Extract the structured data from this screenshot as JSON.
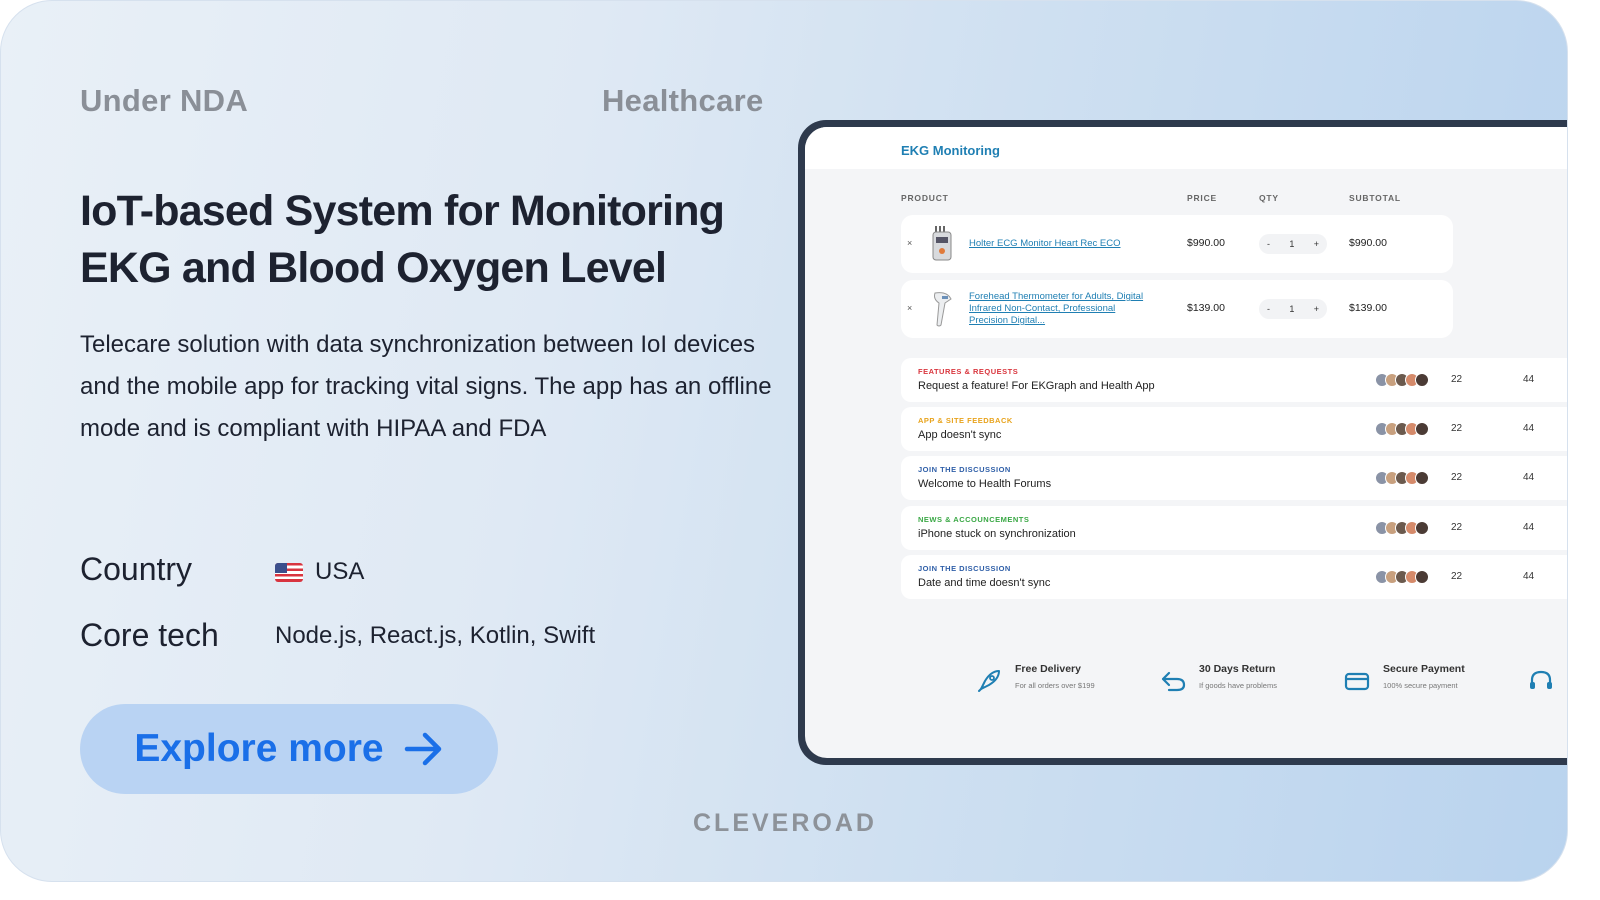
{
  "card": {
    "tag_left": "Under NDA",
    "tag_right": "Healthcare",
    "title": "IoT-based System for Monitoring EKG and Blood Oxygen Level",
    "description": "Telecare solution with data synchronization between IoI devices and the mobile app for tracking vital signs. The app has an offline mode and is compliant with HIPAA and FDA",
    "country_label": "Country",
    "country_value": "USA",
    "tech_label": "Core tech",
    "tech_value": "Node.js, React.js, Kotlin, Swift",
    "button_label": "Explore more",
    "brand": "CLEVEROAD"
  },
  "app": {
    "title": "EKG Monitoring",
    "columns": [
      "PRODUCT",
      "PRICE",
      "QTY",
      "SUBTOTAL"
    ],
    "products": [
      {
        "name": "Holter ECG Monitor Heart Rec ECO",
        "price": "$990.00",
        "qty": "1",
        "subtotal": "$990.00"
      },
      {
        "name": "Forehead Thermometer for Adults, Digital Infrared Non-Contact, Professional Precision Digital...",
        "price": "$139.00",
        "qty": "1",
        "subtotal": "$139.00"
      }
    ],
    "remove_symbol": "×",
    "minus_symbol": "-",
    "plus_symbol": "+",
    "forum": [
      {
        "category": "FEATURES & REQUESTS",
        "color": "#d9363e",
        "title": "Request a feature! For EKGraph and Health App",
        "count1": "22",
        "count2": "44"
      },
      {
        "category": "APP & SITE FEEDBACK",
        "color": "#e8a31c",
        "title": "App doesn't sync",
        "count1": "22",
        "count2": "44"
      },
      {
        "category": "JOIN THE DISCUSSION",
        "color": "#2f5fa8",
        "title": "Welcome to Health Forums",
        "count1": "22",
        "count2": "44"
      },
      {
        "category": "NEWS & ACCOUNCEMENTS",
        "color": "#3aa845",
        "title": "iPhone stuck on synchronization",
        "count1": "22",
        "count2": "44"
      },
      {
        "category": "JOIN THE DISCUSSION",
        "color": "#2f5fa8",
        "title": "Date and time doesn't sync",
        "count1": "22",
        "count2": "44"
      }
    ],
    "features": [
      {
        "icon": "rocket-icon",
        "title": "Free Delivery",
        "subtitle": "For all orders over $199"
      },
      {
        "icon": "return-arrow-icon",
        "title": "30 Days Return",
        "subtitle": "If goods have problems"
      },
      {
        "icon": "credit-card-icon",
        "title": "Secure Payment",
        "subtitle": "100% secure payment"
      }
    ],
    "accent": "#1f7fb3"
  }
}
